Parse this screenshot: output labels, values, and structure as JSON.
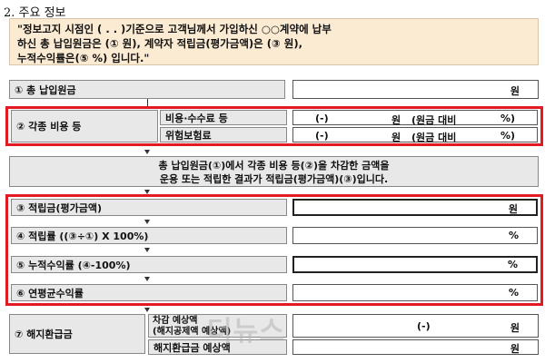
{
  "section_title": "2. 주요 정보",
  "notice": {
    "line1": "\"정보고지 시점인 (    .    .    )기준으로 고객님께서 가입하신 ○○계약에 납부",
    "line2": "하신 총 납입원금은 (①          원), 계약자 적립금(평가금액)은 (③          원),",
    "line3": "누적수익률은(⑤      %) 입니다.\""
  },
  "rows": {
    "total_principal": {
      "label": "① 총 납입원금",
      "unit": "원"
    },
    "fees": {
      "label": "② 각종 비용 등",
      "items": [
        {
          "label": "비용·수수료 등",
          "prefix": "(-)",
          "unit": "원",
          "suffix": "(원금 대비",
          "pct": "%)"
        },
        {
          "label": "위험보험료",
          "prefix": "(-)",
          "unit": "원",
          "suffix": "(원금 대비",
          "pct": "%)"
        }
      ]
    },
    "explain": {
      "line1": "총 납입원금(①)에서 각종 비용 등(②)을 차감한 금액을",
      "line2": "운용 또는 적립한 결과가 적립금(평가금액)(③)입니다."
    },
    "reserve": {
      "label": "③ 적립금(평가금액)",
      "unit": "원"
    },
    "reserve_rate": {
      "label": "④ 적립률 ((③÷①) X 100%)",
      "unit": "%"
    },
    "cum_return": {
      "label": "⑤ 누적수익률 (④-100%)",
      "unit": "%"
    },
    "annual_return": {
      "label": "⑥ 연평균수익률",
      "unit": "%"
    },
    "surrender": {
      "label": "⑦ 해지환급금",
      "sub1_line1": "차감 예상액",
      "sub1_line2": "(해지공제액 예상액)",
      "sub1_prefix": "(-)",
      "sub1_unit": "원",
      "sub2_label": "해지환급금 예상액",
      "sub2_unit": "원"
    }
  },
  "watermark": "더뉴스",
  "colors": {
    "highlight": "#e21b23",
    "notice_bg": "#fcebd3",
    "label_bg": "#e8e8e8"
  }
}
